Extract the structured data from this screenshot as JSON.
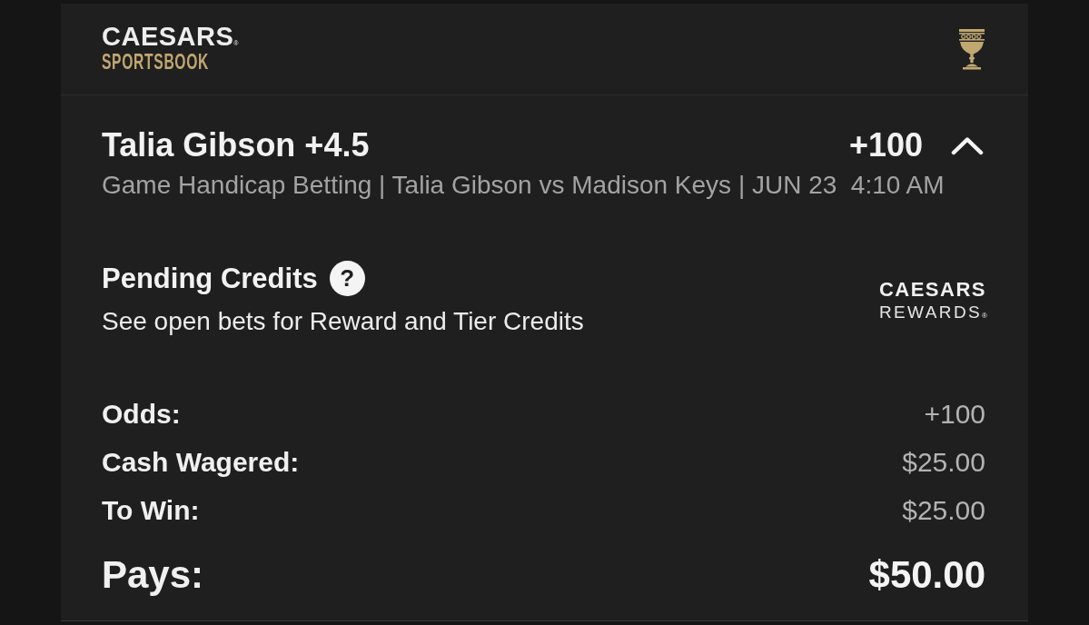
{
  "header": {
    "brand": {
      "name": "CAESARS$_{®}$",
      "sub": "SPORTSBOOK"
    }
  },
  "selection": {
    "title": "Talia Gibson +4.5",
    "odds": "+100",
    "expanded": true,
    "details": "Game Handicap Betting | Talia Gibson vs Madison Keys | JUN 23  4:10 AM"
  },
  "credits": {
    "title": "Pending Credits",
    "help": "?",
    "note": "See open bets for Reward and Tier Credits",
    "rewards_logo": {
      "name": "CAESARS",
      "sub": "REWARDS$_{®}$"
    }
  },
  "summary": [
    {
      "kind": "detail",
      "label": "Odds:",
      "value": "+100"
    },
    {
      "kind": "detail",
      "label": "Cash Wagered:",
      "value": "$25.00"
    },
    {
      "kind": "detail",
      "label": "To Win:",
      "value": "$25.00"
    },
    {
      "kind": "total",
      "label": "Pays:",
      "value": "$50.00"
    }
  ]
}
